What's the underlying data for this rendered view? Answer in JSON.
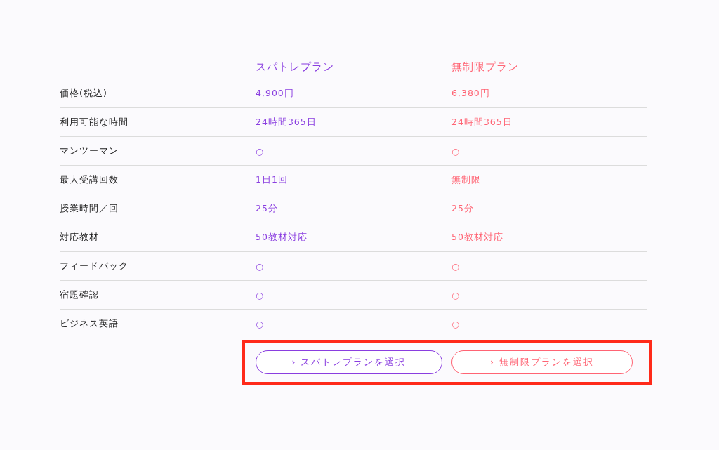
{
  "plans": [
    {
      "name": "スパトレプラン",
      "color": "#8a3ee0",
      "button": "› スパトレプランを選択"
    },
    {
      "name": "無制限プラン",
      "color": "#ff6474",
      "button": "› 無制限プランを選択"
    }
  ],
  "rows": [
    {
      "label": "価格(税込)",
      "values": [
        "4,900円",
        "6,380円"
      ]
    },
    {
      "label": "利用可能な時間",
      "values": [
        "24時間365日",
        "24時間365日"
      ]
    },
    {
      "label": "マンツーマン",
      "values": [
        "○",
        "○"
      ]
    },
    {
      "label": "最大受講回数",
      "values": [
        "1日1回",
        "無制限"
      ]
    },
    {
      "label": "授業時間／回",
      "values": [
        "25分",
        "25分"
      ]
    },
    {
      "label": "対応教材",
      "values": [
        "50教材対応",
        "50教材対応"
      ]
    },
    {
      "label": "フィードバック",
      "values": [
        "○",
        "○"
      ]
    },
    {
      "label": "宿題確認",
      "values": [
        "○",
        "○"
      ]
    },
    {
      "label": "ビジネス英語",
      "values": [
        "○",
        "○"
      ]
    }
  ]
}
